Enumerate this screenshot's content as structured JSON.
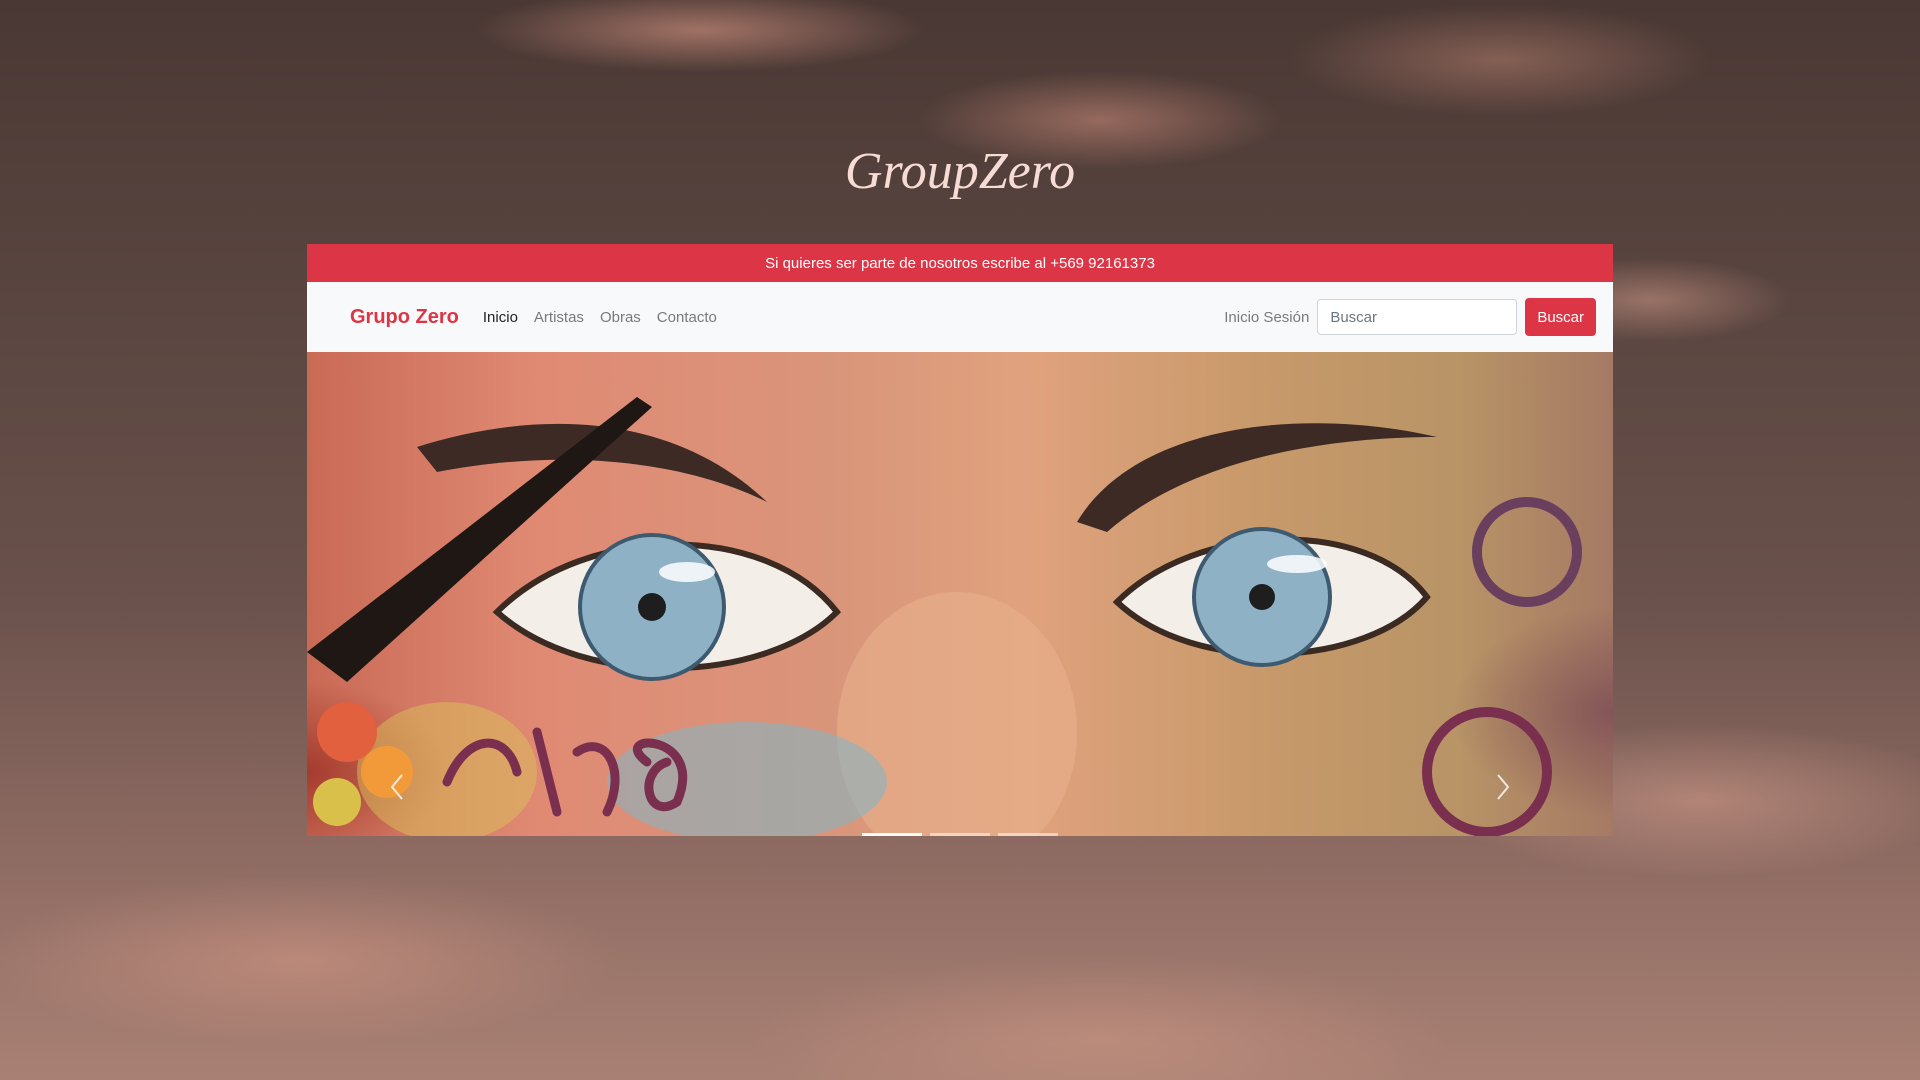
{
  "site_title": "GroupZero",
  "announcement": "Si quieres ser parte de nosotros escribe al +569 92161373",
  "navbar": {
    "brand": "Grupo Zero",
    "links": [
      {
        "label": "Inicio",
        "active": true
      },
      {
        "label": "Artistas",
        "active": false
      },
      {
        "label": "Obras",
        "active": false
      },
      {
        "label": "Contacto",
        "active": false
      }
    ],
    "login_label": "Inicio Sesión",
    "search_placeholder": "Buscar",
    "search_button": "Buscar"
  },
  "carousel": {
    "slide_count": 3,
    "active_slide": 1,
    "prev_icon": "chevron-left-icon",
    "next_icon": "chevron-right-icon"
  },
  "colors": {
    "accent": "#dc3545",
    "navbar_bg": "#f8f9fa",
    "title": "#f6dcd4"
  }
}
